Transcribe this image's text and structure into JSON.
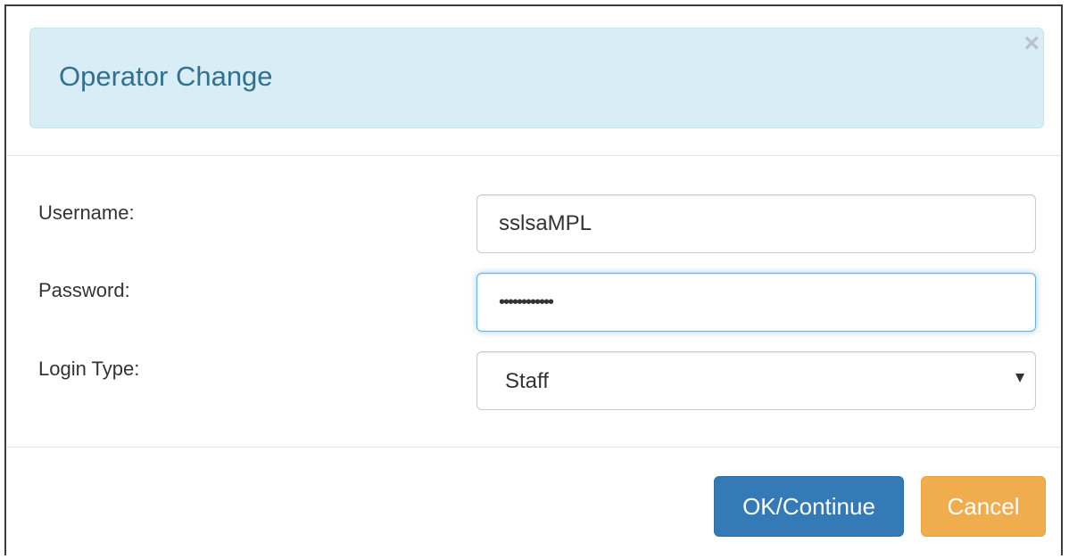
{
  "dialog": {
    "title": "Operator Change",
    "close_symbol": "×"
  },
  "form": {
    "username": {
      "label": "Username:",
      "value": "sslsaMPL"
    },
    "password": {
      "label": "Password:",
      "value": "••••••••••••"
    },
    "login_type": {
      "label": "Login Type:",
      "selected": "Staff"
    }
  },
  "footer": {
    "ok_label": "OK/Continue",
    "cancel_label": "Cancel"
  },
  "colors": {
    "banner_bg": "#d9edf7",
    "title_text": "#31708f",
    "primary_button": "#337ab7",
    "warning_button": "#f0ad4e",
    "focus_ring": "#66afe9"
  },
  "icons": {
    "close": "close-icon",
    "dropdown": "chevron-down-icon"
  }
}
